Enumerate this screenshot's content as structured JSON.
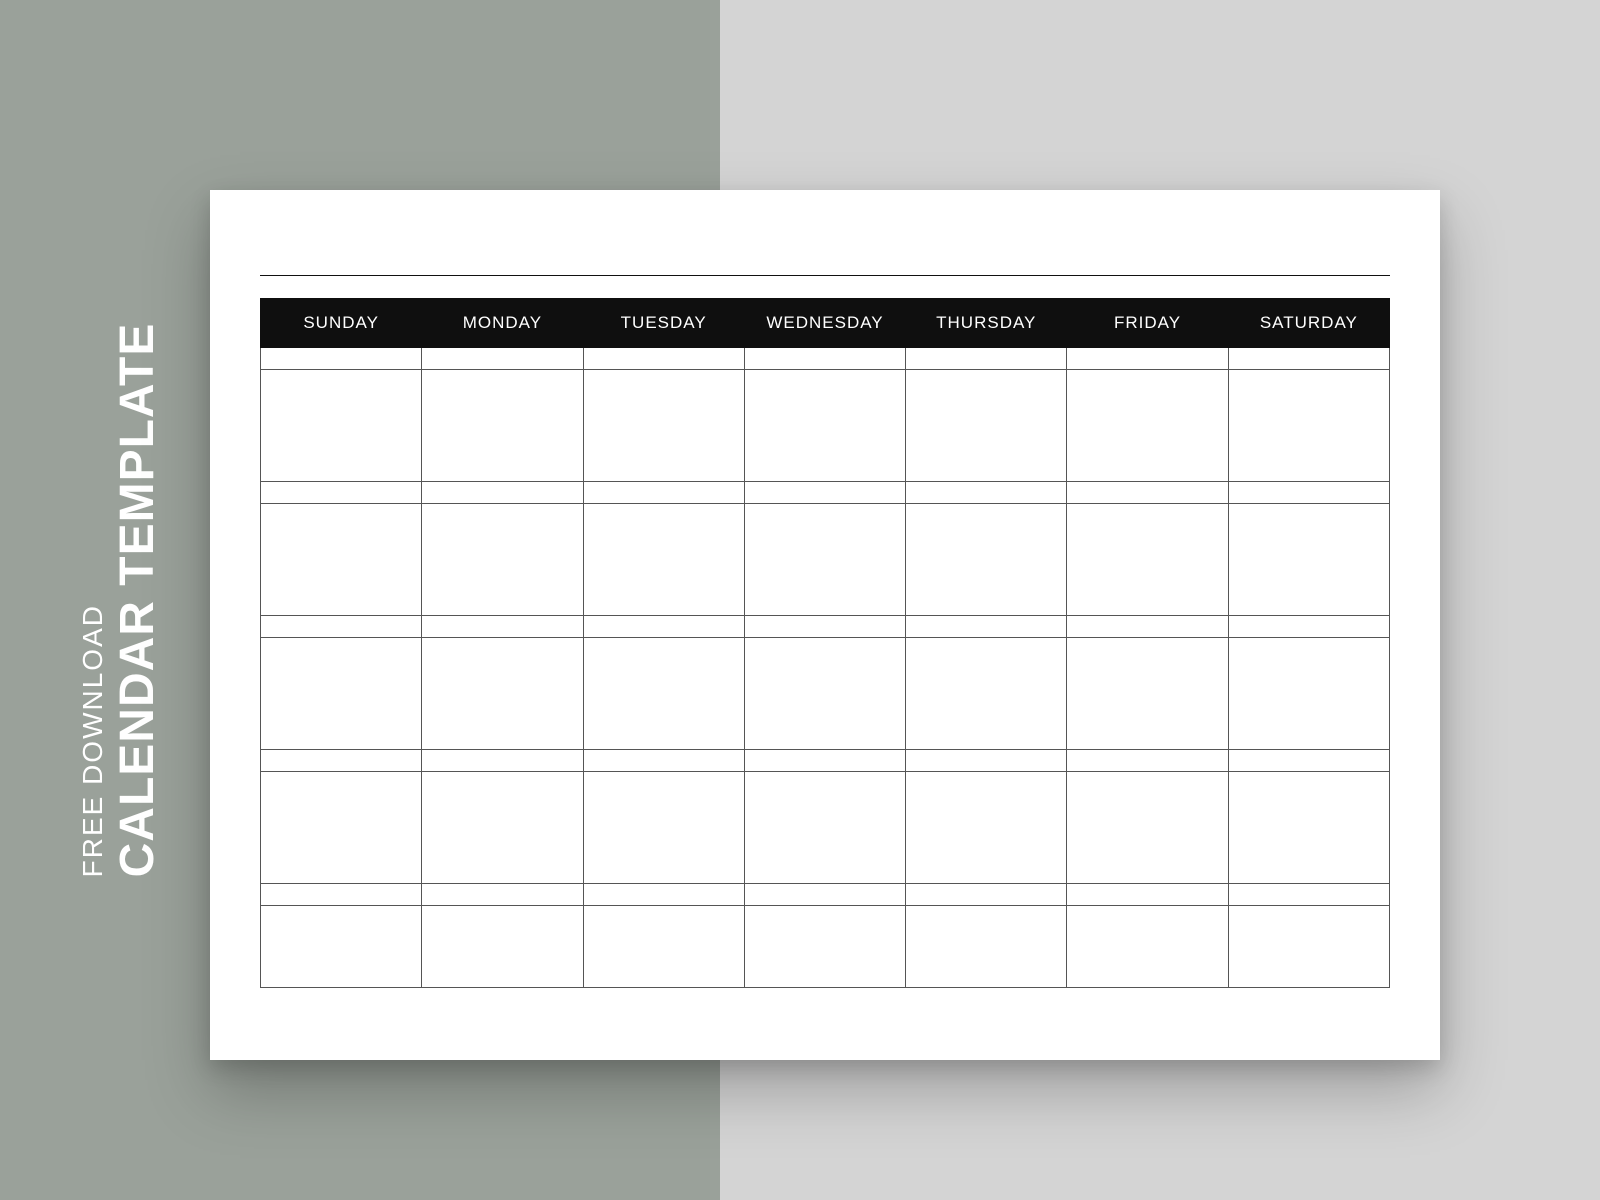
{
  "sidebar": {
    "line1": "FREE DOWNLOAD",
    "line2": "CALENDAR TEMPLATE"
  },
  "calendar": {
    "days": [
      "SUNDAY",
      "MONDAY",
      "TUESDAY",
      "WEDNESDAY",
      "THURSDAY",
      "FRIDAY",
      "SATURDAY"
    ]
  }
}
